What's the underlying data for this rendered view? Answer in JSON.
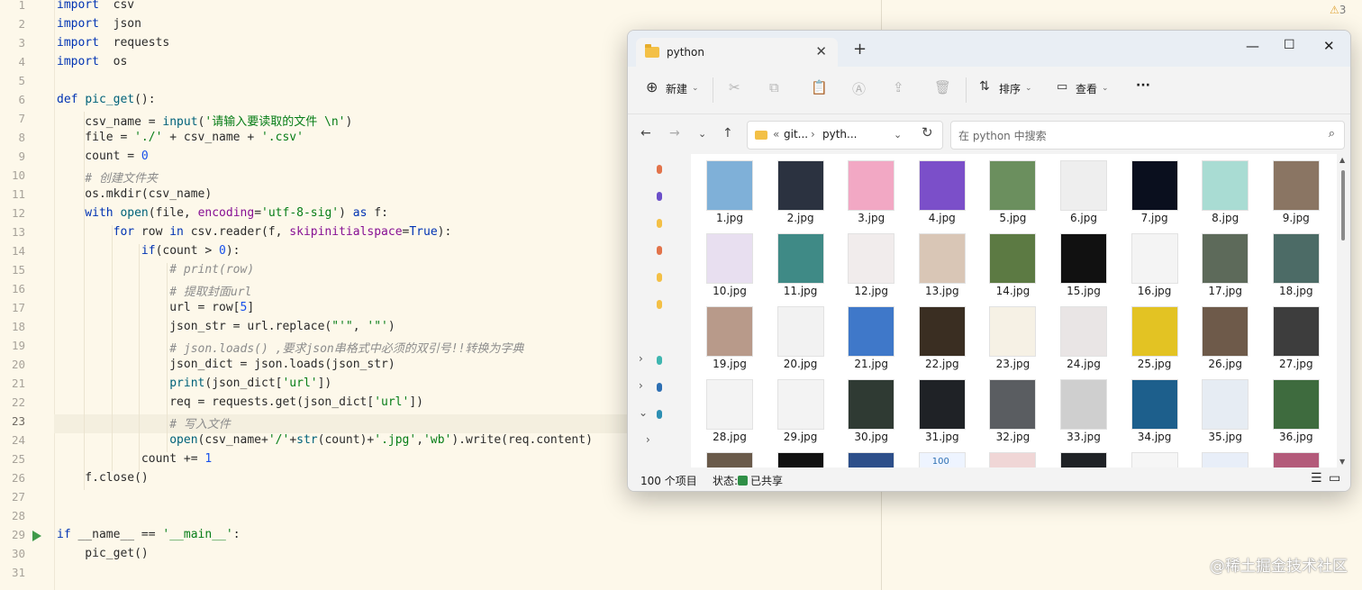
{
  "editor": {
    "warning_count": "3",
    "lines": [
      {
        "n": "1",
        "tokens": [
          [
            "kw",
            "import"
          ],
          [
            "",
            "  csv"
          ]
        ]
      },
      {
        "n": "2",
        "tokens": [
          [
            "kw",
            "import"
          ],
          [
            "",
            "  json"
          ]
        ]
      },
      {
        "n": "3",
        "tokens": [
          [
            "kw",
            "import"
          ],
          [
            "",
            "  requests"
          ]
        ]
      },
      {
        "n": "4",
        "tokens": [
          [
            "kw",
            "import"
          ],
          [
            "",
            "  os"
          ]
        ]
      },
      {
        "n": "5",
        "tokens": []
      },
      {
        "n": "6",
        "tokens": [
          [
            "kw",
            "def "
          ],
          [
            "fn",
            "pic_get"
          ],
          [
            "",
            "():"
          ]
        ]
      },
      {
        "n": "7",
        "tokens": [
          [
            "",
            "    csv_name = "
          ],
          [
            "fn",
            "input"
          ],
          [
            "",
            "("
          ],
          [
            "str",
            "'请输入要读取的文件 \\n'"
          ],
          [
            "",
            ")"
          ]
        ]
      },
      {
        "n": "8",
        "tokens": [
          [
            "",
            "    file = "
          ],
          [
            "str",
            "'./'"
          ],
          [
            "",
            " + csv_name + "
          ],
          [
            "str",
            "'.csv'"
          ]
        ]
      },
      {
        "n": "9",
        "tokens": [
          [
            "",
            "    count = "
          ],
          [
            "num",
            "0"
          ]
        ]
      },
      {
        "n": "10",
        "tokens": [
          [
            "cm",
            "    # 创建文件夹"
          ]
        ]
      },
      {
        "n": "11",
        "tokens": [
          [
            "",
            "    os.mkdir(csv_name)"
          ]
        ]
      },
      {
        "n": "12",
        "tokens": [
          [
            "kw",
            "    with "
          ],
          [
            "fn",
            "open"
          ],
          [
            "",
            "(file, "
          ],
          [
            "param",
            "encoding"
          ],
          [
            "",
            "="
          ],
          [
            "str",
            "'utf-8-sig'"
          ],
          [
            "",
            ") "
          ],
          [
            "kw",
            "as"
          ],
          [
            "",
            " f:"
          ]
        ]
      },
      {
        "n": "13",
        "tokens": [
          [
            "kw",
            "        for "
          ],
          [
            "",
            "row "
          ],
          [
            "kw",
            "in "
          ],
          [
            "",
            "csv.reader(f, "
          ],
          [
            "param",
            "skipinitialspace"
          ],
          [
            "",
            "="
          ],
          [
            "kw",
            "True"
          ],
          [
            "",
            "):"
          ]
        ]
      },
      {
        "n": "14",
        "tokens": [
          [
            "kw",
            "            if"
          ],
          [
            "",
            "(count > "
          ],
          [
            "num",
            "0"
          ],
          [
            "",
            "):"
          ]
        ]
      },
      {
        "n": "15",
        "tokens": [
          [
            "cm",
            "                # print(row)"
          ]
        ]
      },
      {
        "n": "16",
        "tokens": [
          [
            "cm",
            "                # 提取封面url"
          ]
        ]
      },
      {
        "n": "17",
        "tokens": [
          [
            "",
            "                url = row["
          ],
          [
            "num",
            "5"
          ],
          [
            "",
            "]"
          ]
        ]
      },
      {
        "n": "18",
        "tokens": [
          [
            "",
            "                json_str = url.replace("
          ],
          [
            "str",
            "\"'\""
          ],
          [
            "",
            ", "
          ],
          [
            "str",
            "'\"'"
          ],
          [
            "",
            ")"
          ]
        ]
      },
      {
        "n": "19",
        "tokens": [
          [
            "cm",
            "                # json.loads() ,要求json串格式中必须的双引号!!转换为字典"
          ]
        ]
      },
      {
        "n": "20",
        "tokens": [
          [
            "",
            "                json_dict = json.loads(json_str)"
          ]
        ]
      },
      {
        "n": "21",
        "tokens": [
          [
            "fn",
            "                print"
          ],
          [
            "",
            "(json_dict["
          ],
          [
            "str",
            "'url'"
          ],
          [
            "",
            "])"
          ]
        ]
      },
      {
        "n": "22",
        "tokens": [
          [
            "",
            "                req = requests.get(json_dict["
          ],
          [
            "str",
            "'url'"
          ],
          [
            "",
            "])"
          ]
        ]
      },
      {
        "n": "23",
        "tokens": [
          [
            "cm",
            "                # 写入文件"
          ]
        ]
      },
      {
        "n": "24",
        "tokens": [
          [
            "fn",
            "                open"
          ],
          [
            "",
            "(csv_name+"
          ],
          [
            "str",
            "'/'"
          ],
          [
            "",
            "+"
          ],
          [
            "fn",
            "str"
          ],
          [
            "",
            "(count)+"
          ],
          [
            "str",
            "'.jpg'"
          ],
          [
            "",
            ","
          ],
          [
            "str",
            "'wb'"
          ],
          [
            "",
            ").write(req.content)"
          ]
        ]
      },
      {
        "n": "25",
        "tokens": [
          [
            "",
            "            count += "
          ],
          [
            "num",
            "1"
          ]
        ]
      },
      {
        "n": "26",
        "tokens": [
          [
            "",
            "    f.close()"
          ]
        ]
      },
      {
        "n": "27",
        "tokens": []
      },
      {
        "n": "28",
        "tokens": []
      },
      {
        "n": "29",
        "tokens": [
          [
            "kw",
            "if "
          ],
          [
            "",
            "__name__ == "
          ],
          [
            "str",
            "'__main__'"
          ],
          [
            "",
            ":"
          ]
        ]
      },
      {
        "n": "30",
        "tokens": [
          [
            "",
            "    pic_get()"
          ]
        ]
      },
      {
        "n": "31",
        "tokens": []
      }
    ]
  },
  "explorer": {
    "tab_title": "python",
    "toolbar": {
      "new_label": "新建",
      "sort_label": "排序",
      "view_label": "查看",
      "more_label": "···"
    },
    "address": {
      "prefix": "«",
      "segment1": "git...",
      "separator": "›",
      "segment2": "pyth..."
    },
    "search_placeholder": "在 python 中搜索",
    "files": [
      {
        "name": "1.jpg",
        "color": "#7fb0d8"
      },
      {
        "name": "2.jpg",
        "color": "#2b3240"
      },
      {
        "name": "3.jpg",
        "color": "#f2a8c4"
      },
      {
        "name": "4.jpg",
        "color": "#7b4fc9"
      },
      {
        "name": "5.jpg",
        "color": "#6b8f5e"
      },
      {
        "name": "6.jpg",
        "color": "#eeeeee"
      },
      {
        "name": "7.jpg",
        "color": "#0a0f1e"
      },
      {
        "name": "8.jpg",
        "color": "#a9dcd3"
      },
      {
        "name": "9.jpg",
        "color": "#8a7563"
      },
      {
        "name": "10.jpg",
        "color": "#e8dff0"
      },
      {
        "name": "11.jpg",
        "color": "#3f8a86"
      },
      {
        "name": "12.jpg",
        "color": "#f1ecec"
      },
      {
        "name": "13.jpg",
        "color": "#d9c6b6"
      },
      {
        "name": "14.jpg",
        "color": "#5c7a43"
      },
      {
        "name": "15.jpg",
        "color": "#111111"
      },
      {
        "name": "16.jpg",
        "color": "#f4f4f4"
      },
      {
        "name": "17.jpg",
        "color": "#5d6a5a"
      },
      {
        "name": "18.jpg",
        "color": "#4c6b66"
      },
      {
        "name": "19.jpg",
        "color": "#b89a8a"
      },
      {
        "name": "20.jpg",
        "color": "#f2f2f2"
      },
      {
        "name": "21.jpg",
        "color": "#3f78c9"
      },
      {
        "name": "22.jpg",
        "color": "#3a2e22"
      },
      {
        "name": "23.jpg",
        "color": "#f6f1e5"
      },
      {
        "name": "24.jpg",
        "color": "#e9e5e5"
      },
      {
        "name": "25.jpg",
        "color": "#e3c323"
      },
      {
        "name": "26.jpg",
        "color": "#6e5a4a"
      },
      {
        "name": "27.jpg",
        "color": "#3d3d3d"
      },
      {
        "name": "28.jpg",
        "color": "#f3f3f3"
      },
      {
        "name": "29.jpg",
        "color": "#f3f3f3"
      },
      {
        "name": "30.jpg",
        "color": "#2f3a33"
      },
      {
        "name": "31.jpg",
        "color": "#1f2226"
      },
      {
        "name": "32.jpg",
        "color": "#5a5d61"
      },
      {
        "name": "33.jpg",
        "color": "#cfcfcf"
      },
      {
        "name": "34.jpg",
        "color": "#1d5f8c"
      },
      {
        "name": "35.jpg",
        "color": "#e6ecf3"
      },
      {
        "name": "36.jpg",
        "color": "#3e6b3e"
      },
      {
        "name": "",
        "color": "#6a5a4a"
      },
      {
        "name": "",
        "color": "#111111"
      },
      {
        "name": "",
        "color": "#2d4f8a"
      },
      {
        "name": "",
        "color": "#eef4ff"
      },
      {
        "name": "",
        "color": "#f0d6d6"
      },
      {
        "name": "",
        "color": "#1f2226"
      },
      {
        "name": "",
        "color": "#f6f6f6"
      },
      {
        "name": "",
        "color": "#e8eef8"
      },
      {
        "name": "",
        "color": "#b35a7a"
      }
    ],
    "partial_thumb_text": "100",
    "status": {
      "item_count": "100 个项目",
      "state_label": "状态:",
      "state_value": "已共享"
    }
  },
  "watermark": "@稀土掘金技术社区"
}
